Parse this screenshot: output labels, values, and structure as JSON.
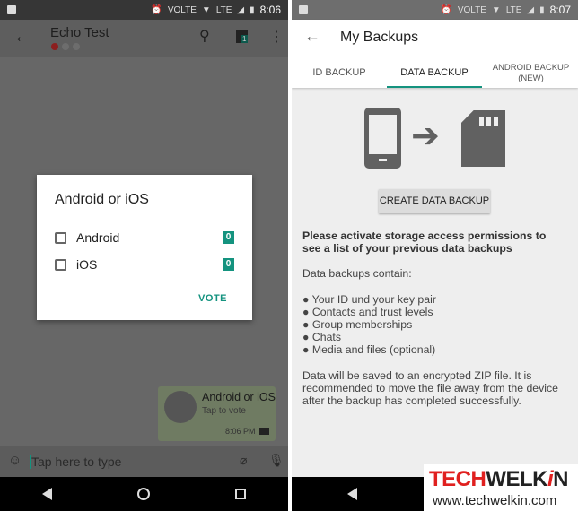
{
  "left": {
    "status": {
      "time": "8:06",
      "volte": "VOLTE",
      "lte": "LTE"
    },
    "toolbar": {
      "title": "Echo Test",
      "badge": "1"
    },
    "poll_dialog": {
      "title": "Android or iOS",
      "options": [
        {
          "label": "Android",
          "count": "0"
        },
        {
          "label": "iOS",
          "count": "0"
        }
      ],
      "vote_label": "VOTE"
    },
    "message": {
      "title": "Android or iOS",
      "subtitle": "Tap to vote",
      "time": "8:06 PM"
    },
    "input": {
      "placeholder": "Tap here to type"
    }
  },
  "right": {
    "status": {
      "time": "8:07",
      "volte": "VOLTE",
      "lte": "LTE"
    },
    "header": {
      "title": "My Backups"
    },
    "tabs": [
      {
        "label": "ID BACKUP"
      },
      {
        "label": "DATA BACKUP",
        "active": true
      },
      {
        "label": "ANDROID BACKUP\n(NEW)"
      }
    ],
    "create_button": "CREATE DATA BACKUP",
    "permission_text": "Please activate storage access permissions to see a list of your previous data backups",
    "contains_heading": "Data backups contain:",
    "contains": [
      "● Your ID und your key pair",
      "● Contacts and trust levels",
      "● Group memberships",
      "● Chats",
      "● Media and files (optional)"
    ],
    "footer_text": "Data will be saved to an encrypted ZIP file. It is recommended to move the file away from the device after the backup has completed successfully."
  },
  "watermark": {
    "brand": "TECHWELKiN",
    "url": "www.techwelkin.com"
  },
  "colors": {
    "accent": "#14937f",
    "brand_red": "#e0201f"
  }
}
